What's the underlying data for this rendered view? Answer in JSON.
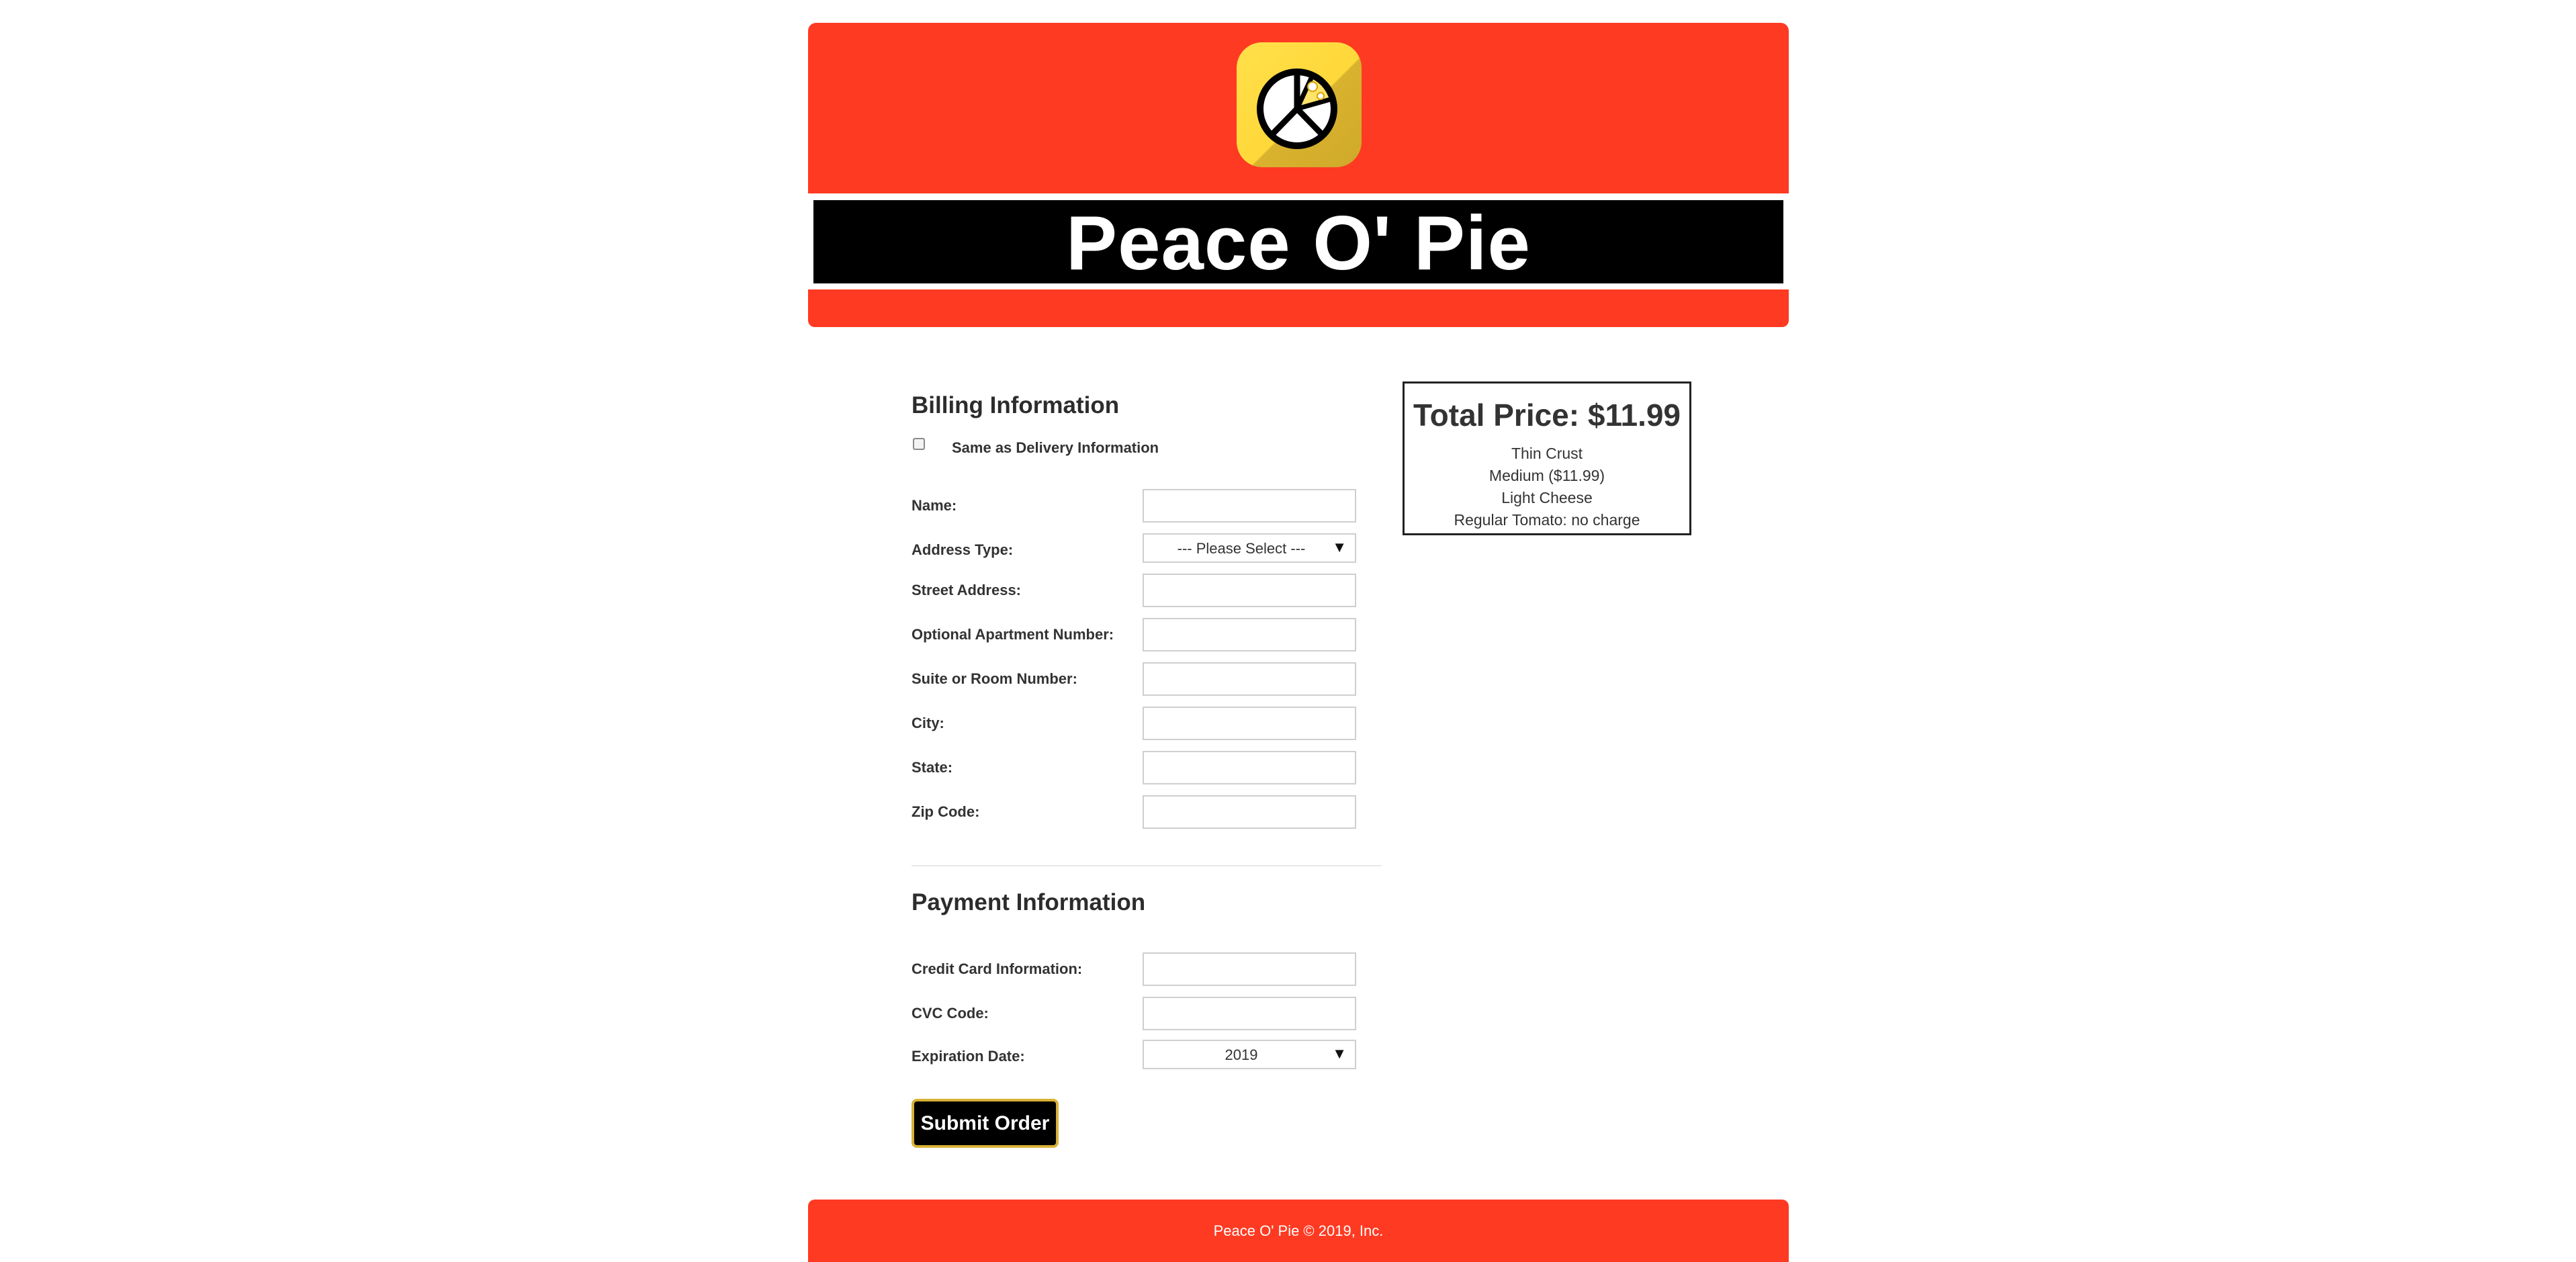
{
  "header": {
    "logo_icon": "pizza-peace-icon",
    "title": "Peace O' Pie",
    "brand_color": "#ff3a22",
    "title_bar_color": "#000000",
    "logo_color": "#ffd83a"
  },
  "billing": {
    "heading": "Billing Information",
    "same_as_delivery": {
      "label": "Same as Delivery Information",
      "checked": false
    },
    "fields": {
      "name": {
        "label": "Name:",
        "value": ""
      },
      "address_type": {
        "label": "Address Type:",
        "selected": "--- Please Select ---"
      },
      "street": {
        "label": "Street Address:",
        "value": ""
      },
      "apartment": {
        "label": "Optional Apartment Number:",
        "value": ""
      },
      "suite": {
        "label": "Suite or Room Number:",
        "value": ""
      },
      "city": {
        "label": "City:",
        "value": ""
      },
      "state": {
        "label": "State:",
        "value": ""
      },
      "zip": {
        "label": "Zip Code:",
        "value": ""
      }
    }
  },
  "payment": {
    "heading": "Payment Information",
    "fields": {
      "credit_card": {
        "label": "Credit Card Information:",
        "value": ""
      },
      "cvc": {
        "label": "CVC Code:",
        "value": ""
      },
      "expiration": {
        "label": "Expiration Date:",
        "selected": "2019"
      }
    },
    "submit_label": "Submit Order",
    "submit_border_color": "#d8b236"
  },
  "summary": {
    "total": "Total Price: $11.99",
    "items": [
      "Thin Crust",
      "Medium ($11.99)",
      "Light Cheese",
      "Regular Tomato: no charge"
    ]
  },
  "footer": {
    "copyright": "Peace O' Pie © 2019, Inc."
  }
}
